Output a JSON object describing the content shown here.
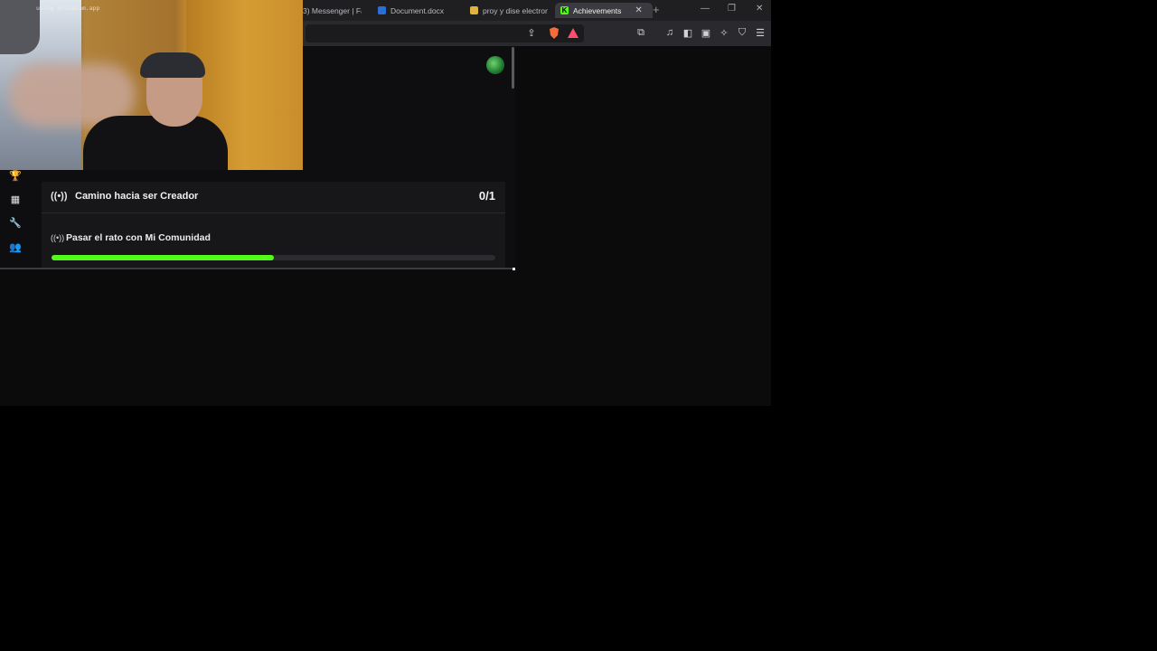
{
  "browser": {
    "tabs": [
      {
        "label": "3) Messenger | Fa",
        "icon": "messenger-icon",
        "active": false
      },
      {
        "label": "Document.docx",
        "icon": "word-doc-icon",
        "active": false
      },
      {
        "label": "proy y dise electron",
        "icon": "image-icon",
        "active": false
      },
      {
        "label": "Achievements",
        "icon": "kick-icon",
        "active": true
      }
    ],
    "new_tab_label": "+",
    "close_tab_label": "✕"
  },
  "webcam": {
    "watermark": "using droidcam.app"
  },
  "achievements": {
    "card_title": "Camino hacia ser Creador",
    "card_count": "0/1",
    "task_title": "Pasar el rato con Mi Comunidad",
    "task_progress": 0.5
  },
  "colors": {
    "accent": "#53fc18",
    "card_bg": "#17171a",
    "page_bg": "#0e0e10"
  }
}
